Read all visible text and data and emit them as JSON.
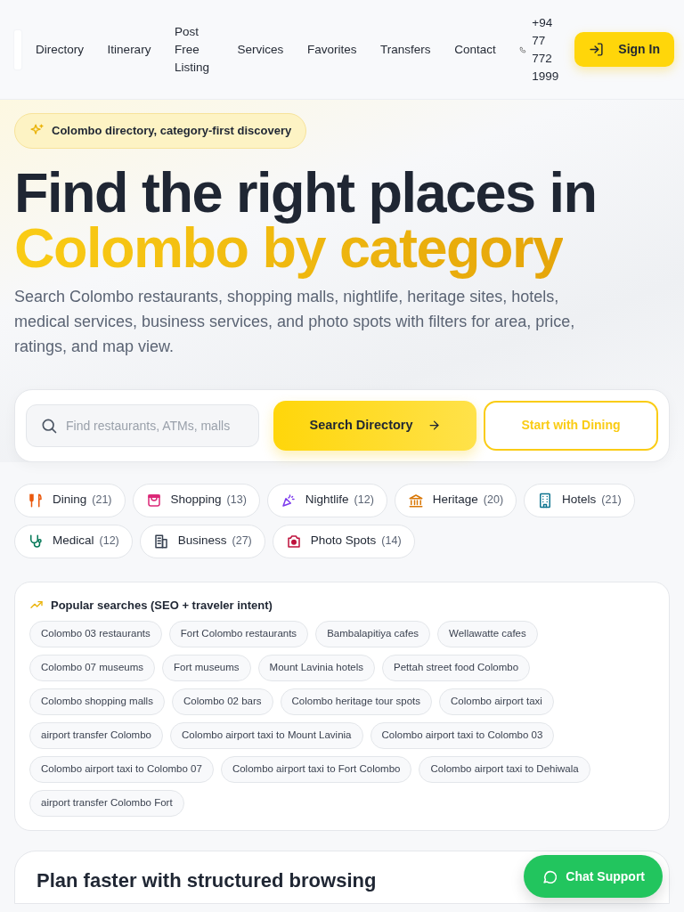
{
  "nav": {
    "items": [
      "Directory",
      "Itinerary",
      "Post Free Listing",
      "Services",
      "Favorites",
      "Transfers",
      "Contact"
    ],
    "phone": "+94 77 772 1999",
    "sign_in": "Sign In"
  },
  "hero": {
    "badge": "Colombo directory, category-first discovery",
    "title_line1": "Find the right places in",
    "title_line2": "Colombo by category",
    "description": "Search Colombo restaurants, shopping malls, nightlife, heritage sites, hotels, medical services, business services, and photo spots with filters for area, price, ratings, and map view."
  },
  "search": {
    "placeholder": "Find restaurants, ATMs, malls",
    "primary_button": "Search Directory",
    "secondary_button": "Start with Dining"
  },
  "categories": [
    {
      "label": "Dining",
      "count": "(21)",
      "color": "#ea580c"
    },
    {
      "label": "Shopping",
      "count": "(13)",
      "color": "#db2777"
    },
    {
      "label": "Nightlife",
      "count": "(12)",
      "color": "#7c3aed"
    },
    {
      "label": "Heritage",
      "count": "(20)",
      "color": "#d97706"
    },
    {
      "label": "Hotels",
      "count": "(21)",
      "color": "#0e7490"
    },
    {
      "label": "Medical",
      "count": "(12)",
      "color": "#047857"
    },
    {
      "label": "Business",
      "count": "(27)",
      "color": "#374151"
    },
    {
      "label": "Photo Spots",
      "count": "(14)",
      "color": "#be123c"
    }
  ],
  "popular": {
    "title": "Popular searches (SEO + traveler intent)",
    "tags": [
      "Colombo 03 restaurants",
      "Fort Colombo restaurants",
      "Bambalapitiya cafes",
      "Wellawatte cafes",
      "Colombo 07 museums",
      "Fort museums",
      "Mount Lavinia hotels",
      "Pettah street food Colombo",
      "Colombo shopping malls",
      "Colombo 02 bars",
      "Colombo heritage tour spots",
      "Colombo airport taxi",
      "airport transfer Colombo",
      "Colombo airport taxi to Mount Lavinia",
      "Colombo airport taxi to Colombo 03",
      "Colombo airport taxi to Colombo 07",
      "Colombo airport taxi to Fort Colombo",
      "Colombo airport taxi to Dehiwala",
      "airport transfer Colombo Fort"
    ]
  },
  "next_section": {
    "title": "Plan faster with structured browsing"
  },
  "chat": {
    "label": "Chat Support"
  }
}
